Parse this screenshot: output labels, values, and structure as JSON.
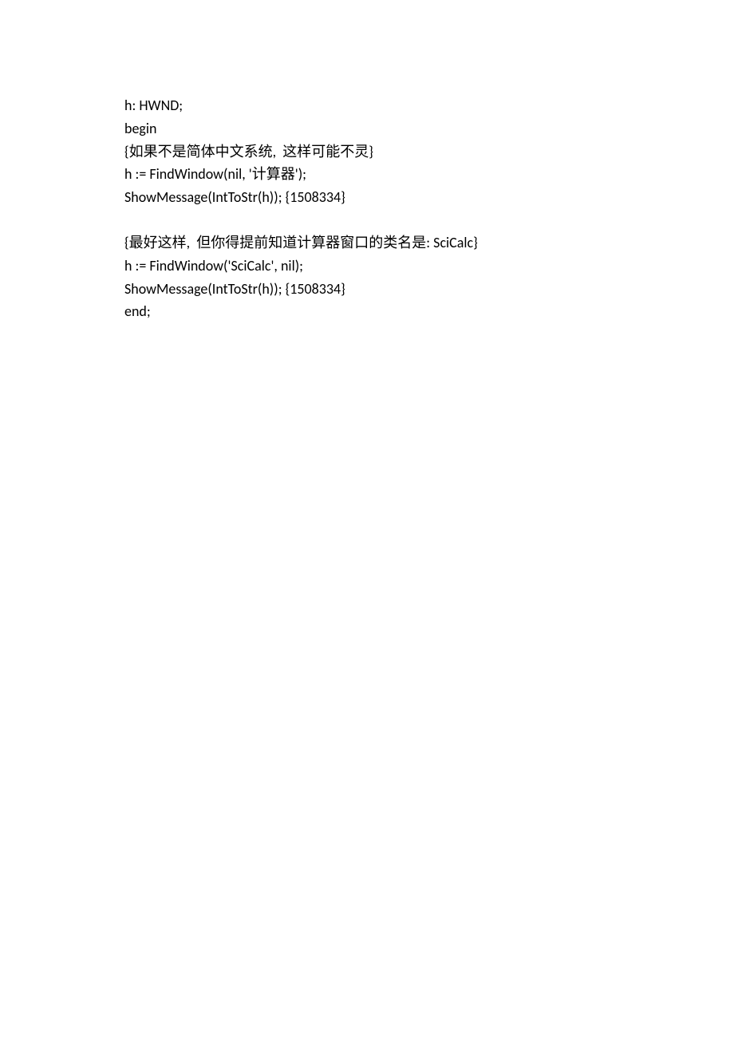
{
  "code": {
    "lines": [
      "h: HWND;",
      "begin",
      "{如果不是简体中文系统,  这样可能不灵}",
      "h := FindWindow(nil, '计算器');",
      "ShowMessage(IntToStr(h)); {1508334}",
      "",
      "{最好这样,  但你得提前知道计算器窗口的类名是: SciCalc}",
      "h := FindWindow('SciCalc', nil);",
      "ShowMessage(IntToStr(h)); {1508334}",
      "end;"
    ]
  }
}
